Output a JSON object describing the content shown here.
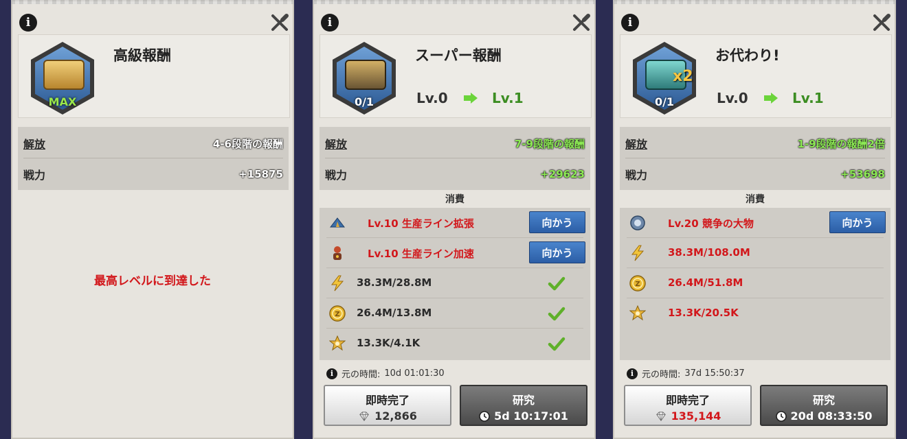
{
  "panels": [
    {
      "title": "高級報酬",
      "badge": "MAX",
      "stats": {
        "unlock_label": "解放",
        "unlock_value": "4-6段階の報酬",
        "power_label": "戦力",
        "power_value": "+15875"
      },
      "max_message": "最高レベルに到達した"
    },
    {
      "title": "スーパー報酬",
      "badge": "0/1",
      "level_from": "Lv.0",
      "level_to": "Lv.1",
      "stats": {
        "unlock_label": "解放",
        "unlock_value": "7-9段階の報酬",
        "power_label": "戦力",
        "power_value": "+29623"
      },
      "consume_title": "消費",
      "requirements": [
        {
          "icon": "tent-icon",
          "text": "Lv.10 生産ライン拡張",
          "button": "向かう"
        },
        {
          "icon": "worker-icon",
          "text": "Lv.10 生産ライン加速",
          "button": "向かう"
        },
        {
          "icon": "lightning-icon",
          "text": "38.3M/28.8M",
          "met": true
        },
        {
          "icon": "coin-icon",
          "text": "26.4M/13.8M",
          "met": true
        },
        {
          "icon": "star-badge-icon",
          "text": "13.3K/4.1K",
          "met": true
        }
      ],
      "original_time_label": "元の時間:",
      "original_time_value": "10d 01:01:30",
      "instant_label": "即時完了",
      "instant_cost": "12,866",
      "research_label": "研究",
      "research_time": "5d 10:17:01"
    },
    {
      "title": "お代わり!",
      "badge": "0/1",
      "multiplier": "x2",
      "level_from": "Lv.0",
      "level_to": "Lv.1",
      "stats": {
        "unlock_label": "解放",
        "unlock_value": "1-9段階の報酬2倍",
        "power_label": "戦力",
        "power_value": "+53698"
      },
      "consume_title": "消費",
      "requirements": [
        {
          "icon": "medal-icon",
          "text": "Lv.20 競争の大物",
          "button": "向かう"
        },
        {
          "icon": "lightning-icon",
          "text": "38.3M/108.0M"
        },
        {
          "icon": "coin-icon",
          "text": "26.4M/51.8M"
        },
        {
          "icon": "star-badge-icon",
          "text": "13.3K/20.5K"
        }
      ],
      "original_time_label": "元の時間:",
      "original_time_value": "37d 15:50:37",
      "instant_label": "即時完了",
      "instant_cost": "135,144",
      "research_label": "研究",
      "research_time": "20d 08:33:50"
    }
  ],
  "colors": {
    "insufficient": "#d2171b",
    "sufficient": "#8dea55",
    "button_blue": "#2c5ea6"
  }
}
